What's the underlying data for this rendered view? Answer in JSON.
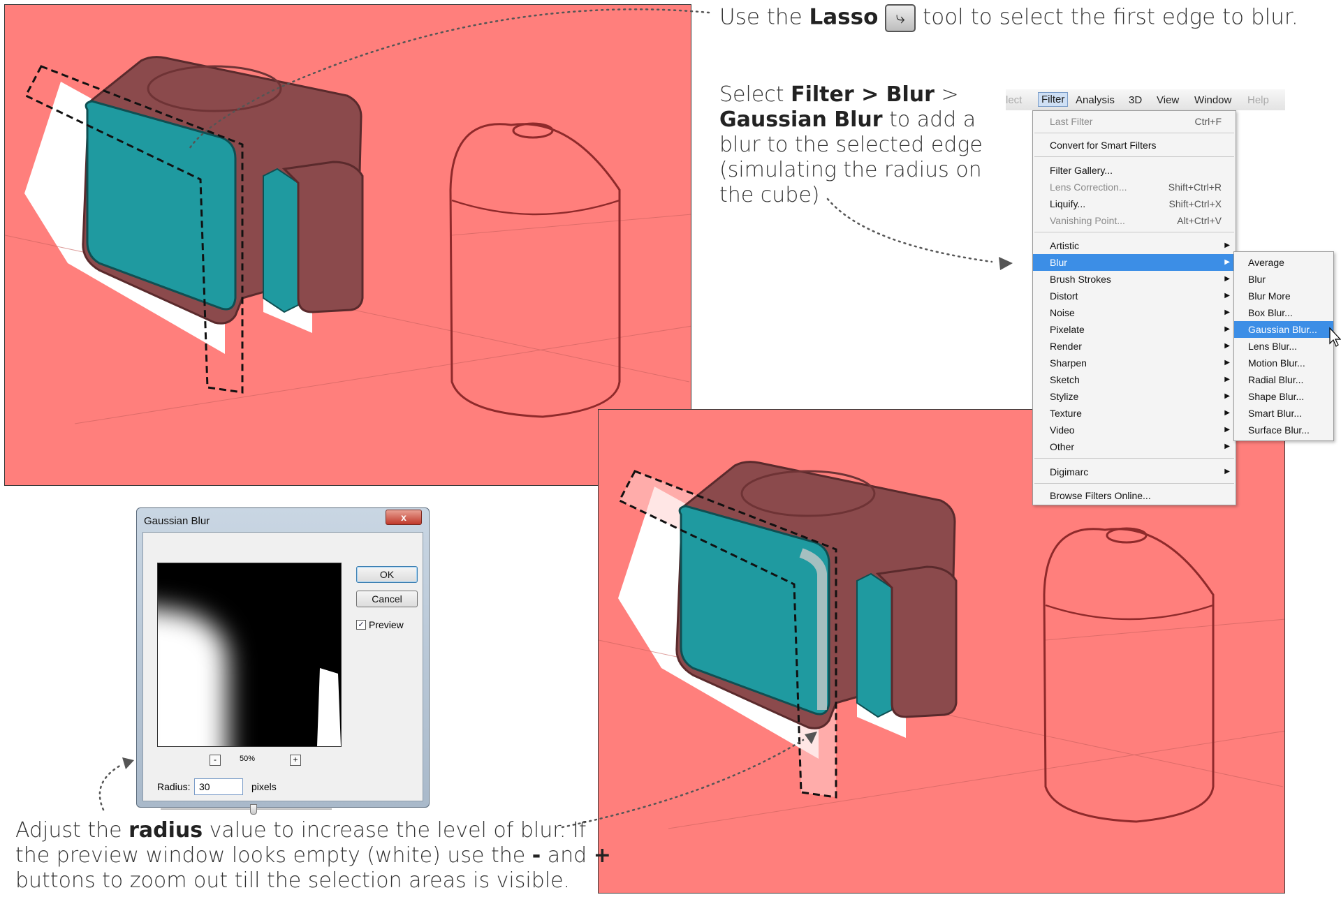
{
  "captions": {
    "lasso_pre": "Use the ",
    "lasso_bold": "Lasso",
    "lasso_post": " tool to select the first edge to blur.",
    "filter_line1_pre": "Select ",
    "filter_line1_bold": "Filter > Blur",
    "filter_line1_post": " >",
    "filter_line2_bold": "Gaussian Blur",
    "filter_line2_post": " to add a",
    "filter_line3": "blur to the selected edge",
    "filter_line4": "(simulating the radius on",
    "filter_line5": "the cube)",
    "radius_line1_pre": "Adjust the ",
    "radius_line1_bold": "radius",
    "radius_line1_post": " value to increase the level of blur. If",
    "radius_line2_pre": "the preview window looks empty (white) use the ",
    "radius_line2_minus": "-",
    "radius_line2_mid": " and ",
    "radius_line2_plus": "+",
    "radius_line3": "buttons to zoom out till the selection areas is visible."
  },
  "menubar": {
    "items": [
      "lect",
      "Filter",
      "Analysis",
      "3D",
      "View",
      "Window",
      "Help"
    ]
  },
  "filter_menu": {
    "items": [
      {
        "label": "Last Filter",
        "shortcut": "Ctrl+F",
        "disabled": true
      },
      {
        "label": "Convert for Smart Filters"
      },
      {
        "label": "Filter Gallery..."
      },
      {
        "label": "Lens Correction...",
        "shortcut": "Shift+Ctrl+R",
        "disabled": true
      },
      {
        "label": "Liquify...",
        "shortcut": "Shift+Ctrl+X"
      },
      {
        "label": "Vanishing Point...",
        "shortcut": "Alt+Ctrl+V",
        "disabled": true
      },
      {
        "label": "Artistic"
      },
      {
        "label": "Blur",
        "selected": true
      },
      {
        "label": "Brush Strokes"
      },
      {
        "label": "Distort"
      },
      {
        "label": "Noise"
      },
      {
        "label": "Pixelate"
      },
      {
        "label": "Render"
      },
      {
        "label": "Sharpen"
      },
      {
        "label": "Sketch"
      },
      {
        "label": "Stylize"
      },
      {
        "label": "Texture"
      },
      {
        "label": "Video"
      },
      {
        "label": "Other"
      },
      {
        "label": "Digimarc"
      },
      {
        "label": "Browse Filters Online..."
      }
    ]
  },
  "blur_submenu": {
    "items": [
      "Average",
      "Blur",
      "Blur More",
      "Box Blur...",
      "Gaussian Blur...",
      "Lens Blur...",
      "Motion Blur...",
      "Radial Blur...",
      "Shape Blur...",
      "Smart Blur...",
      "Surface Blur..."
    ],
    "selected": "Gaussian Blur..."
  },
  "dialog": {
    "title": "Gaussian Blur",
    "close": "x",
    "ok": "OK",
    "cancel": "Cancel",
    "preview_label": "Preview",
    "preview_checked": true,
    "zoom_minus": "-",
    "zoom_plus": "+",
    "zoom_level": "50%",
    "radius_label": "Radius:",
    "radius_value": "30",
    "radius_unit": "pixels"
  },
  "colors": {
    "background_fill": "#ff7f7c",
    "cube_top": "#8b4a4c",
    "screen_teal": "#1f9aa0",
    "selection_blue": "#3c8ee6"
  }
}
